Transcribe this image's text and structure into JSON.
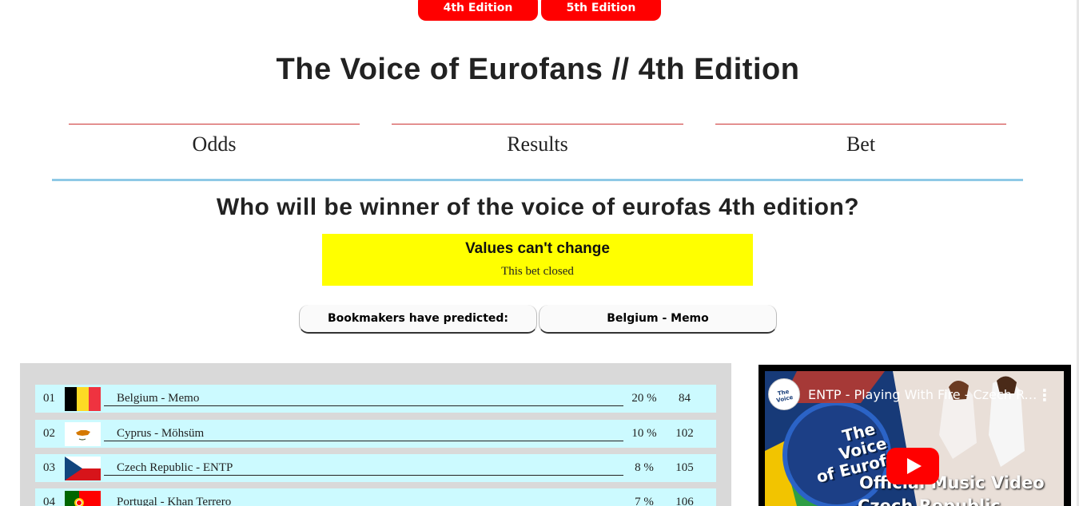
{
  "editions": {
    "ed4_label": "4th Edition",
    "ed5_label": "5th Edition"
  },
  "page_title": "The Voice of Eurofans // 4th Edition",
  "tabs": [
    {
      "label": "Odds"
    },
    {
      "label": "Results"
    },
    {
      "label": "Bet"
    }
  ],
  "question": "Who will be winner of the voice of eurofas 4th edition?",
  "notice": {
    "title": "Values can't change",
    "subtitle": "This bet closed"
  },
  "prediction": {
    "label": "Bookmakers have predicted:",
    "value": "Belgium - Memo"
  },
  "colors": {
    "edition_button": "#ff0000",
    "tab_rule": "#cc3333",
    "divider": "#8ec9e6",
    "notice_bg": "#ffff00",
    "row_bg": "#ccfaff",
    "panel_bg": "#d9d9d9"
  },
  "entries": [
    {
      "position": "01",
      "name": "Belgium - Memo",
      "percent": "20 %",
      "odds": "84",
      "flag": "belgium-flag"
    },
    {
      "position": "02",
      "name": "Cyprus - Möhsüm",
      "percent": "10 %",
      "odds": "102",
      "flag": "cyprus-flag"
    },
    {
      "position": "03",
      "name": "Czech Republic - ENTP",
      "percent": "8 %",
      "odds": "105",
      "flag": "czech-flag"
    },
    {
      "position": "04",
      "name": "Portugal - Khan Terrero",
      "percent": "7 %",
      "odds": "106",
      "flag": "portugal-flag"
    }
  ],
  "video": {
    "title": "ENTP - Playing With Fire - Czech Republic",
    "channel_avatar_text": "The Voice of Eurofans",
    "logo_text": "The Voice of Eurofans",
    "overlay_line1": "Official Music Video",
    "overlay_line2": "Czech Republic"
  }
}
